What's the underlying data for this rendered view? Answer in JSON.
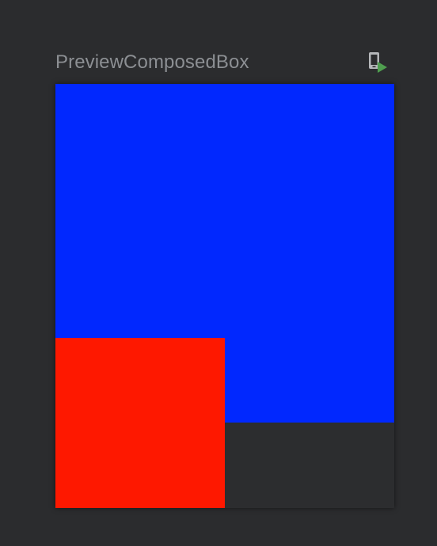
{
  "preview": {
    "title": "PreviewComposedBox",
    "deploy_icon": "deploy-to-device-icon"
  },
  "colors": {
    "background": "#2b2c2e",
    "title_text": "#8c8f93",
    "blue_box": "#0128fe",
    "red_box": "#fe1800",
    "icon_device": "#b4b6b9",
    "icon_play": "#4f9e4f"
  }
}
